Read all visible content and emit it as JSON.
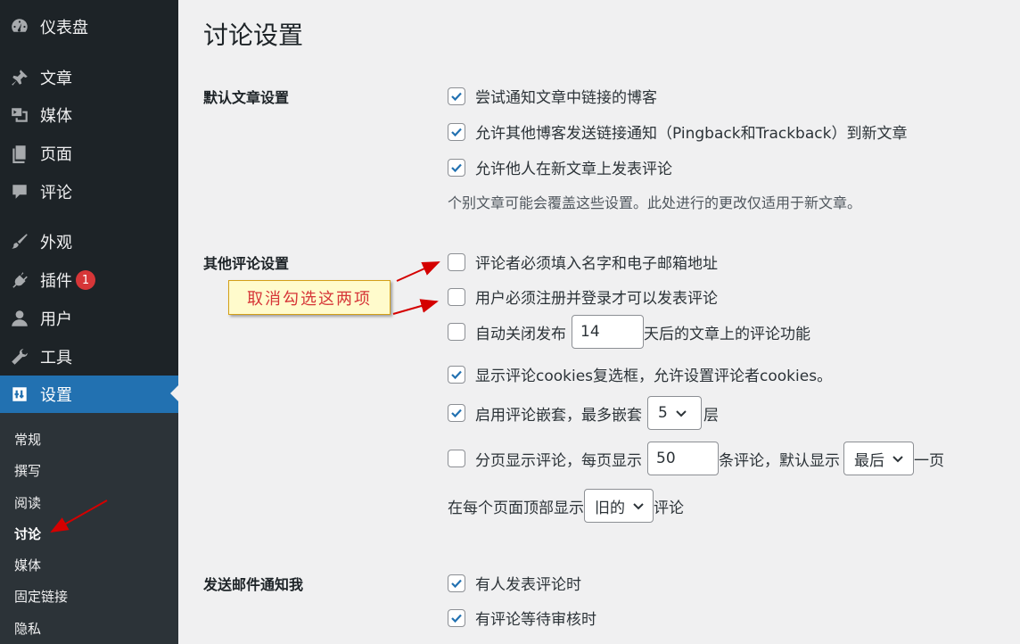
{
  "sidebar": {
    "items": [
      {
        "label": "仪表盘",
        "icon": "dashboard-icon"
      },
      {
        "label": "文章",
        "icon": "pin-icon"
      },
      {
        "label": "媒体",
        "icon": "media-icon"
      },
      {
        "label": "页面",
        "icon": "pages-icon"
      },
      {
        "label": "评论",
        "icon": "comment-icon"
      },
      {
        "label": "外观",
        "icon": "brush-icon"
      },
      {
        "label": "插件",
        "icon": "plugin-icon",
        "badge": "1"
      },
      {
        "label": "用户",
        "icon": "user-icon"
      },
      {
        "label": "工具",
        "icon": "wrench-icon"
      },
      {
        "label": "设置",
        "icon": "settings-icon",
        "active": true
      }
    ],
    "submenu": [
      "常规",
      "撰写",
      "阅读",
      "讨论",
      "媒体",
      "固定链接",
      "隐私"
    ],
    "current_submenu": "讨论"
  },
  "page": {
    "title": "讨论设置"
  },
  "sections": {
    "default_article": {
      "label": "默认文章设置",
      "options": [
        {
          "label": "尝试通知文章中链接的博客",
          "checked": true
        },
        {
          "label": "允许其他博客发送链接通知（Pingback和Trackback）到新文章",
          "checked": true
        },
        {
          "label": "允许他人在新文章上发表评论",
          "checked": true
        }
      ],
      "description": "个别文章可能会覆盖这些设置。此处进行的更改仅适用于新文章。"
    },
    "other_comment": {
      "label": "其他评论设置",
      "require_name_email": {
        "label": "评论者必须填入名字和电子邮箱地址",
        "checked": false
      },
      "require_registration": {
        "label": "用户必须注册并登录才可以发表评论",
        "checked": false
      },
      "auto_close": {
        "label_before": "自动关闭发布",
        "days": "14",
        "label_after": "天后的文章上的评论功能",
        "checked": false
      },
      "cookies": {
        "label": "显示评论cookies复选框，允许设置评论者cookies。",
        "checked": true
      },
      "threaded": {
        "label_before": "启用评论嵌套，最多嵌套",
        "depth": "5",
        "label_after": "层",
        "checked": true
      },
      "paged": {
        "label_before": "分页显示评论，每页显示",
        "per_page": "50",
        "label_middle": "条评论，默认显示",
        "default_page": "最后",
        "label_after": "一页",
        "checked": false
      },
      "order": {
        "label_before": "在每个页面顶部显示",
        "value": "旧的",
        "label_after": "评论"
      }
    },
    "email_me": {
      "label": "发送邮件通知我",
      "options": [
        {
          "label": "有人发表评论时",
          "checked": true
        },
        {
          "label": "有评论等待审核时",
          "checked": true
        }
      ]
    }
  },
  "annotation": {
    "text": "取消勾选这两项"
  },
  "colors": {
    "sidebar_bg": "#1d2327",
    "submenu_bg": "#2c3338",
    "accent": "#2271b1",
    "badge": "#d63638",
    "annotation_text": "#d63638",
    "arrow": "#d40000"
  }
}
